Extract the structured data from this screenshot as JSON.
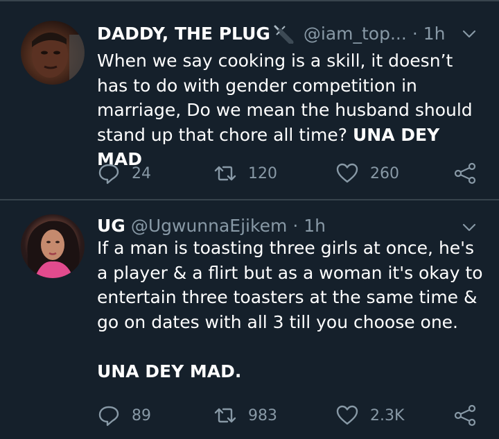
{
  "tweets": [
    {
      "display_name": "DADDY, THE PLUG",
      "name_icon": "plug-icon",
      "handle": "@iam_top...",
      "separator": "·",
      "time": "1h",
      "text_lines": [
        "When we say cooking is a skill, it doesn’t",
        "has to do with gender competition in",
        "marriage, Do we mean the husband should",
        "stand up that chore all time? "
      ],
      "text_bold": "UNA DEY MAD",
      "replies": "24",
      "retweets": "120",
      "likes": "260"
    },
    {
      "display_name": "UG",
      "handle": "@UgwunnaEjikem",
      "separator": "·",
      "time": "1h",
      "text_lines": [
        "If a man is toasting three girls at once, he's",
        "a player & a flirt but as a woman it's okay to",
        "entertain three toasters at the same time &",
        "go on dates with all 3 till you choose one."
      ],
      "text_bold": "UNA DEY MAD.",
      "replies": "89",
      "retweets": "983",
      "likes": "2.3K"
    }
  ],
  "colors": {
    "background": "#15202b",
    "divider": "#38444d",
    "secondary_text": "#8899a6",
    "primary_text": "#ffffff"
  },
  "icons": [
    "reply-icon",
    "retweet-icon",
    "like-icon",
    "share-icon",
    "chevron-down-icon"
  ]
}
